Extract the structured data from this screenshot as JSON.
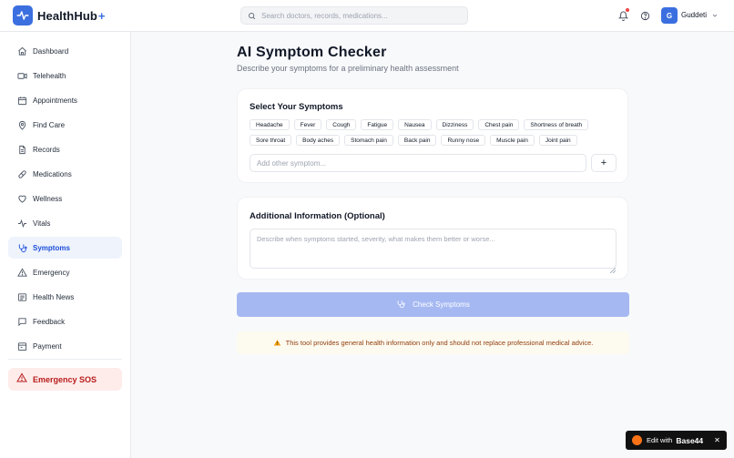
{
  "app": {
    "name": "HealthHub",
    "name_suffix": "+"
  },
  "header": {
    "search_placeholder": "Search doctors, records, medications...",
    "user_initial": "G",
    "user_name": "Guddeti"
  },
  "sidebar": {
    "items": [
      {
        "label": "Dashboard",
        "icon": "home-icon"
      },
      {
        "label": "Telehealth",
        "icon": "video-icon"
      },
      {
        "label": "Appointments",
        "icon": "calendar-icon"
      },
      {
        "label": "Find Care",
        "icon": "map-pin-icon"
      },
      {
        "label": "Records",
        "icon": "file-icon"
      },
      {
        "label": "Medications",
        "icon": "pill-icon"
      },
      {
        "label": "Wellness",
        "icon": "heart-icon"
      },
      {
        "label": "Vitals",
        "icon": "activity-icon"
      },
      {
        "label": "Symptoms",
        "icon": "stethoscope-icon",
        "active": true
      },
      {
        "label": "Emergency",
        "icon": "alert-triangle-icon"
      },
      {
        "label": "Health News",
        "icon": "newspaper-icon"
      },
      {
        "label": "Feedback",
        "icon": "message-icon"
      },
      {
        "label": "Payment",
        "icon": "payment-icon"
      }
    ],
    "sos_label": "Emergency SOS"
  },
  "main": {
    "title": "AI Symptom Checker",
    "subtitle": "Describe your symptoms for a preliminary health assessment",
    "symptoms_card": {
      "title": "Select Your Symptoms",
      "row1": [
        "Headache",
        "Fever",
        "Cough",
        "Fatigue",
        "Nausea",
        "Dizziness",
        "Chest pain",
        "Shortness of breath"
      ],
      "row2": [
        "Sore throat",
        "Body aches",
        "Stomach pain",
        "Back pain",
        "Runny nose",
        "Muscle pain",
        "Joint pain"
      ],
      "other_placeholder": "Add other symptom...",
      "add_label": "+"
    },
    "info_card": {
      "title": "Additional Information (Optional)",
      "placeholder": "Describe when symptoms started, severity, what makes them better or worse..."
    },
    "check_button": "Check Symptoms",
    "disclaimer": "This tool provides general health information only and should not replace professional medical advice."
  },
  "badge": {
    "edit_text": "Edit with",
    "brand": "Base44",
    "close": "✕"
  },
  "colors": {
    "primary": "#3b6fe0",
    "button_disabled": "#a5b8f2",
    "sos_bg": "#fdecea",
    "sos_text": "#b91c1c",
    "warning_text": "#92400e"
  }
}
